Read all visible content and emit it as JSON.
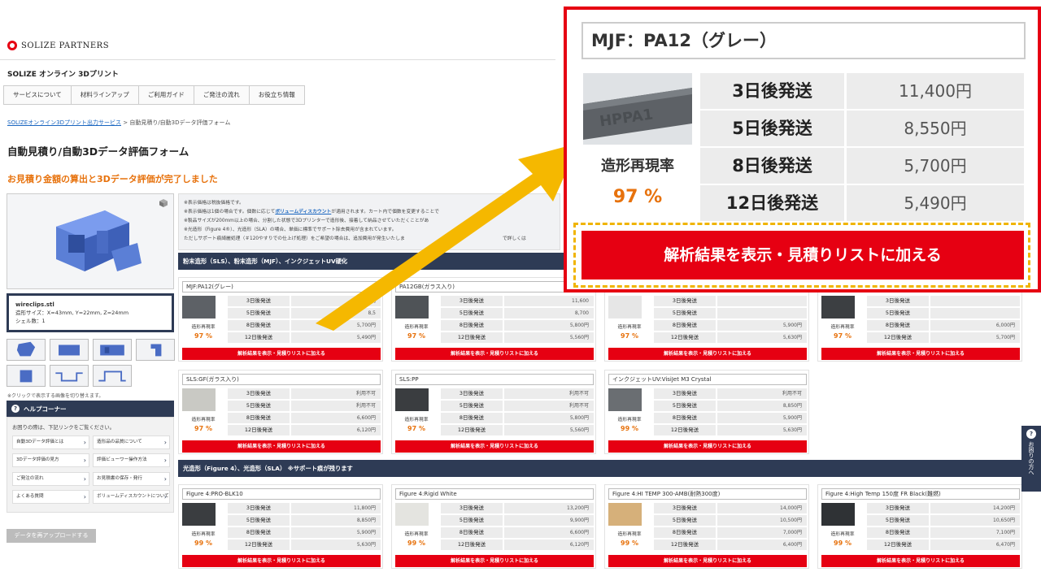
{
  "header": {
    "brand": "SOLIZE PARTNERS",
    "site_name": "SOLIZE オンライン 3Dプリント"
  },
  "nav": [
    {
      "label": "サービスについて"
    },
    {
      "label": "材料ラインアップ"
    },
    {
      "label": "ご利用ガイド"
    },
    {
      "label": "ご発注の流れ"
    },
    {
      "label": "お役立ち情報"
    }
  ],
  "breadcrumb": {
    "home": "SOLIZEオンライン3Dプリント出力サービス",
    "sep": ">",
    "current": "自動見積り/自動3Dデータ評価フォーム"
  },
  "page": {
    "title": "自動見積り/自動3Dデータ評価フォーム",
    "subtitle": "お見積り金額の算出と3Dデータ評価が完了しました"
  },
  "file": {
    "name": "wireclips.stl",
    "size": "造形サイズ：X=43mm, Y=22mm, Z=24mm",
    "shells": "シェル数：1"
  },
  "thumbnail_note": "※クリックで表示する画像を切り替えます。",
  "help": {
    "title": "ヘルプコーナー",
    "text": "お困りの際は、下記リンクをご覧ください。",
    "links": [
      {
        "label": "自動3Dデータ評価とは"
      },
      {
        "label": "造形品の品質について"
      },
      {
        "label": "3Dデータ評価の見方"
      },
      {
        "label": "評価ビューワー操作方法"
      },
      {
        "label": "ご発注の流れ"
      },
      {
        "label": "お見積書の保存・発行"
      },
      {
        "label": "よくある質問"
      },
      {
        "label": "ボリュームディスカウントについて"
      }
    ]
  },
  "reupload_label": "データを再アップロードする",
  "notice": {
    "lines": [
      "※表示価格は税抜価格です。",
      "※表示価格は1個の場合です。個数に応じて",
      "ボリュームディスカウント",
      "が適用されます。カート内で個数を変更することで",
      "※製品サイズが200mm以上の場合、分割した状態で3Dプリンターで造形後、接着して納品させていただくことがあ",
      "※光造形（Figure 4®）、光造形（SLA）の場合、単価に標準でサポート除去費用が含まれています。",
      "ただしサポート痕綺麗処理（＃120やすりでの仕上げ処理）をご希望の場合は、追加費用が発生いたしま",
      "で詳しくは"
    ]
  },
  "sections": {
    "powder": "粉末造形（SLS）、粉末造形（MJF）、インクジェットUV硬化",
    "photo": "光造形（Figure 4）、光造形（SLA） ※サポート痕が残ります"
  },
  "labels": {
    "rate": "造形再現率",
    "add_button": "解析結果を表示・見積りリストに加える"
  },
  "days": [
    "3日後発送",
    "5日後発送",
    "8日後発送",
    "12日後発送"
  ],
  "cards": [
    {
      "title": "MJF:PA12(グレー)",
      "rate": "97 %",
      "prices": [
        "11,400円",
        "8,5",
        "5,700円",
        "5,490円"
      ]
    },
    {
      "title": "PA12GB(ガラス入り)",
      "rate": "97 %",
      "prices": [
        "11,600",
        "8,700",
        "5,800円",
        "5,560円"
      ]
    },
    {
      "title": "",
      "rate": "97 %",
      "prices": [
        "",
        "",
        "5,900円",
        "5,630円"
      ]
    },
    {
      "title": "",
      "rate": "97 %",
      "prices": [
        "",
        "",
        "6,000円",
        "5,700円"
      ]
    },
    {
      "title": "SLS:GF(ガラス入り)",
      "rate": "97 %",
      "prices": [
        "利用不可",
        "利用不可",
        "6,600円",
        "6,120円"
      ]
    },
    {
      "title": "SLS:PP",
      "rate": "97 %",
      "prices": [
        "利用不可",
        "利用不可",
        "5,800円",
        "5,560円"
      ]
    },
    {
      "title": "インクジェットUV:VisiJet M3 Crystal",
      "rate": "99 %",
      "prices": [
        "利用不可",
        "8,850円",
        "5,900円",
        "5,630円"
      ]
    },
    {
      "title": "Figure 4:PRO-BLK10",
      "rate": "99 %",
      "prices": [
        "11,800円",
        "8,850円",
        "5,900円",
        "5,630円"
      ]
    },
    {
      "title": "Figure 4:Rigid White",
      "rate": "99 %",
      "prices": [
        "13,200円",
        "9,900円",
        "6,600円",
        "6,120円"
      ]
    },
    {
      "title": "Figure 4:HI TEMP 300-AMB(耐熱300度)",
      "rate": "99 %",
      "prices": [
        "14,000円",
        "10,500円",
        "7,000円",
        "6,400円"
      ]
    },
    {
      "title": "Figure 4:High Temp 150度 FR Black(難燃)",
      "rate": "99 %",
      "prices": [
        "14,200円",
        "10,650円",
        "7,100円",
        "6,470円"
      ]
    }
  ],
  "zoom": {
    "title": "MJF：PA12（グレー）",
    "rate_label": "造形再現率",
    "rate": "97 %",
    "rows": [
      {
        "days": "3日後発送",
        "price": "11,400円"
      },
      {
        "days": "5日後発送",
        "price": "8,550円"
      },
      {
        "days": "8日後発送",
        "price": "5,700円"
      },
      {
        "days": "12日後発送",
        "price": "5,490円"
      }
    ],
    "button": "解析結果を表示・見積りリストに加える"
  },
  "side_tab": {
    "icon": "?",
    "label": "お困りの方へ"
  },
  "colors": {
    "brand_red": "#e60012",
    "accent_orange": "#e7720d",
    "navy": "#2e3b55",
    "arrow_yellow": "#f5b800"
  }
}
